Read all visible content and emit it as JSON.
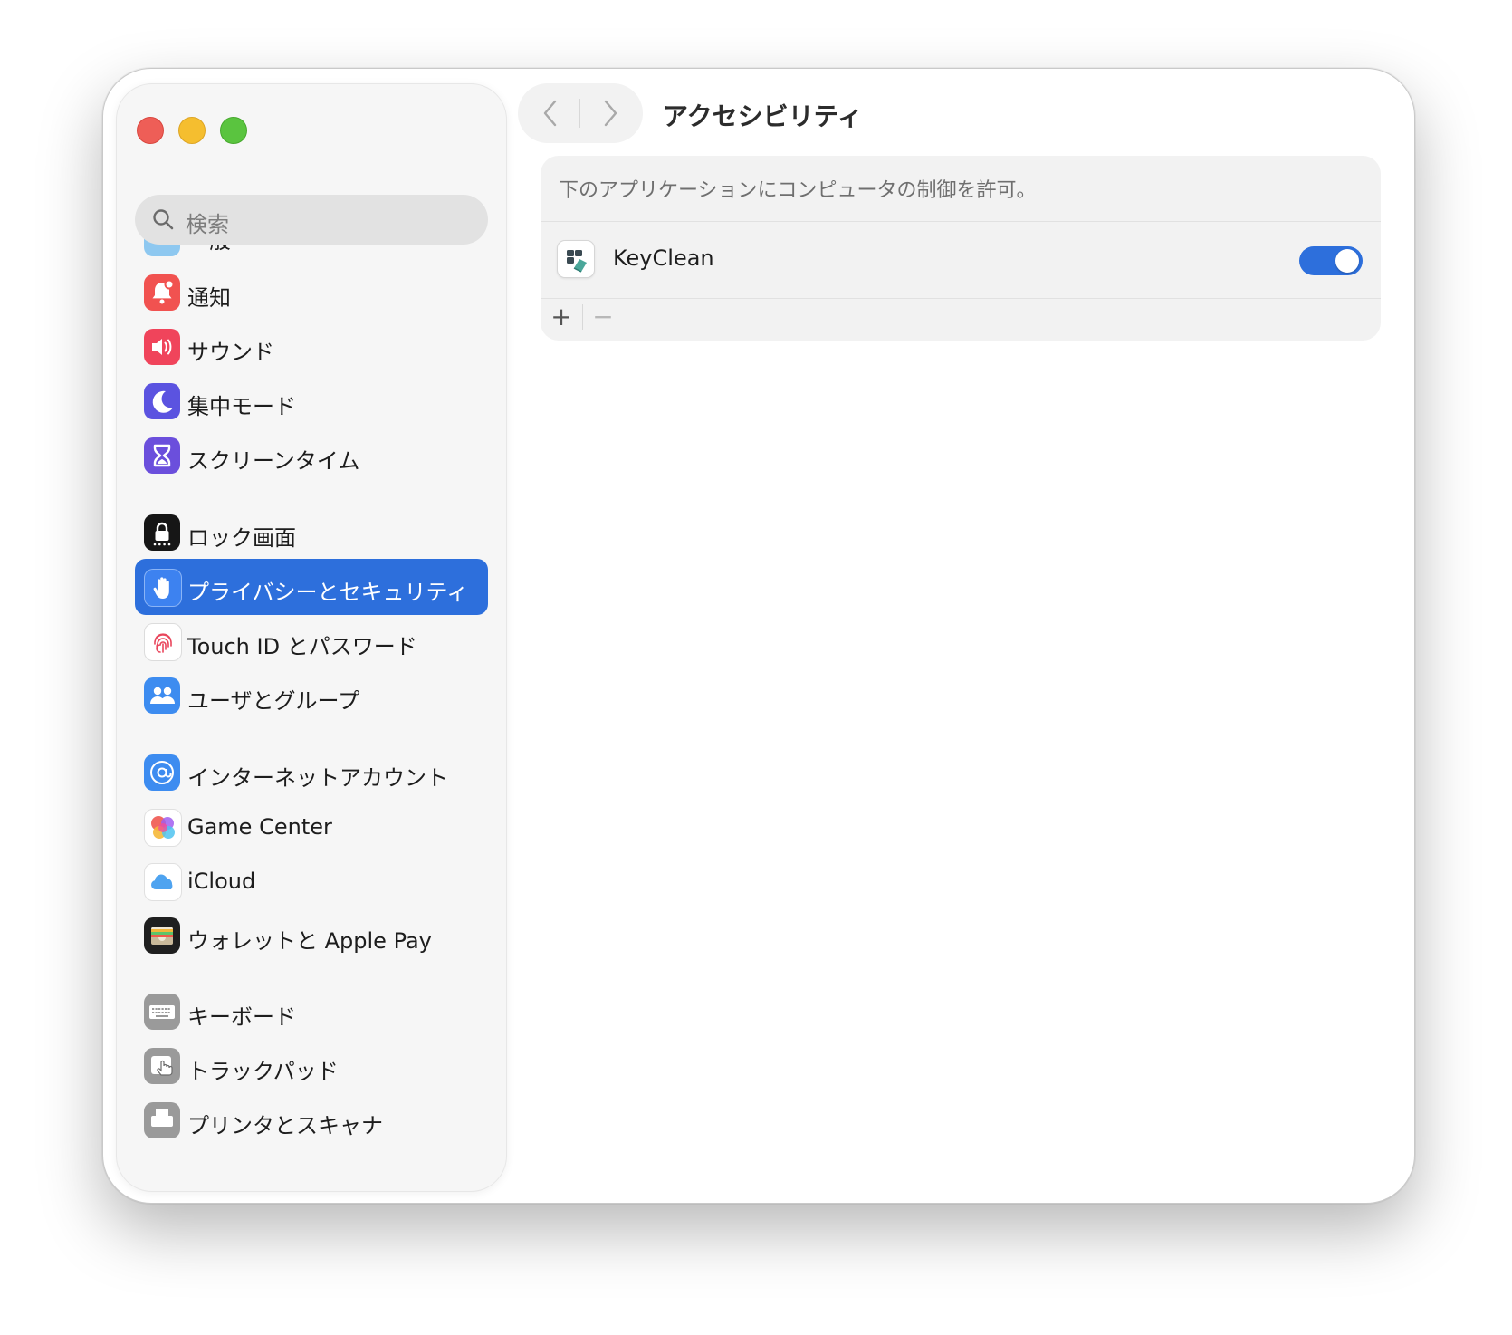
{
  "sidebar": {
    "search_placeholder": "検索",
    "cut_top_item": "一般",
    "items": [
      {
        "label": "通知",
        "icon": "bell-badge-icon",
        "color": "#f15250"
      },
      {
        "label": "サウンド",
        "icon": "speaker-wave-icon",
        "color": "#f0445b"
      },
      {
        "label": "集中モード",
        "icon": "moon-icon",
        "color": "#5b53e0"
      },
      {
        "label": "スクリーンタイム",
        "icon": "hourglass-icon",
        "color": "#6b4fdc"
      },
      {
        "label": "ロック画面",
        "icon": "lock-icon",
        "color": "#161616"
      },
      {
        "label": "プライバシーとセキュリティ",
        "icon": "hand-raised-icon",
        "color": "#3d82f0",
        "selected": true
      },
      {
        "label": "Touch ID とパスワード",
        "icon": "fingerprint-icon",
        "color": "#ffffff"
      },
      {
        "label": "ユーザとグループ",
        "icon": "people-icon",
        "color": "#3d8cf0"
      },
      {
        "label": "インターネットアカウント",
        "icon": "at-sign-icon",
        "color": "#3d8cf0"
      },
      {
        "label": "Game Center",
        "icon": "game-center-icon",
        "color": "#ffffff"
      },
      {
        "label": "iCloud",
        "icon": "cloud-icon",
        "color": "#ffffff"
      },
      {
        "label": "ウォレットと Apple Pay",
        "icon": "wallet-icon",
        "color": "#1f1f1f"
      },
      {
        "label": "キーボード",
        "icon": "keyboard-icon",
        "color": "#9a9a9a"
      },
      {
        "label": "トラックパッド",
        "icon": "trackpad-icon",
        "color": "#9a9a9a"
      },
      {
        "label": "プリンタとスキャナ",
        "icon": "printer-icon",
        "color": "#9a9a9a"
      }
    ]
  },
  "header": {
    "title": "アクセシビリティ"
  },
  "panel": {
    "description": "下のアプリケーションにコンピュータの制御を許可。",
    "apps": [
      {
        "name": "KeyClean",
        "enabled": true
      }
    ],
    "add_label": "+",
    "remove_label": "−"
  },
  "colors": {
    "accent": "#2d6fdc",
    "traffic_close": "#ee5e57",
    "traffic_minimize": "#f5be2f",
    "traffic_maximize": "#5ac43f"
  }
}
